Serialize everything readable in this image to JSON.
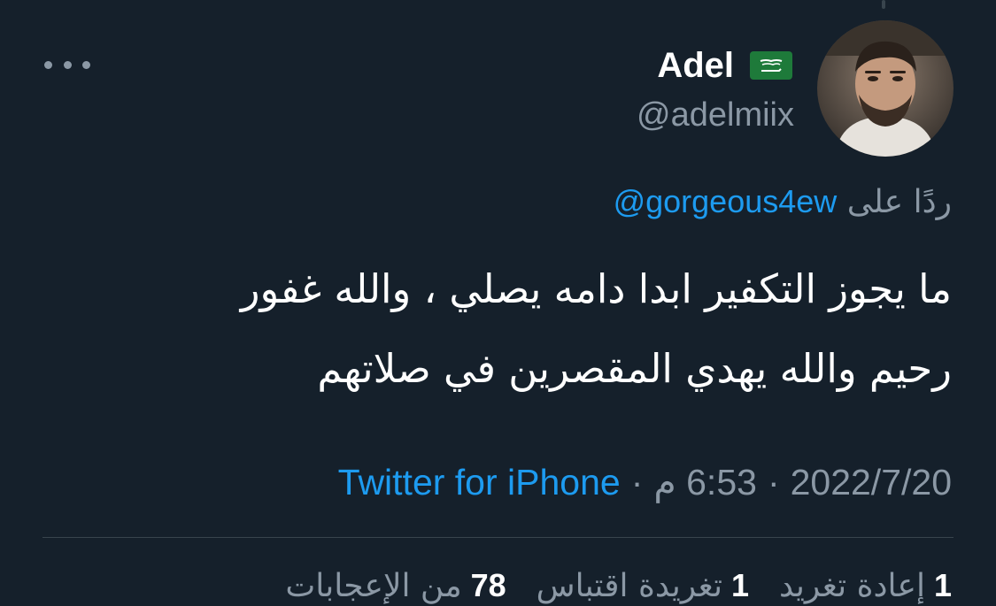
{
  "author": {
    "display_name": "Adel",
    "handle": "@adelmiix",
    "flag_icon": "saudi-flag-icon",
    "avatar_icon": "user-avatar"
  },
  "reply": {
    "prefix": "ردًا على",
    "mention": "@gorgeous4ew"
  },
  "tweet": {
    "line1": "ما يجوز التكفير ابدا دامه يصلي ، والله غفور",
    "line2": "رحيم والله يهدي المقصرين في صلاتهم"
  },
  "meta": {
    "date": "2022/7/20",
    "time": "6:53 م",
    "separator": "·",
    "source": "Twitter for iPhone"
  },
  "stats": [
    {
      "count": "1",
      "label": "إعادة تغريد"
    },
    {
      "count": "1",
      "label": "تغريدة اقتباس"
    },
    {
      "count": "78",
      "label": "من الإعجابات"
    }
  ],
  "colors": {
    "background": "#15202b",
    "accent": "#1d9bf0",
    "secondary_text": "#8b98a5",
    "divider": "#38444d"
  }
}
